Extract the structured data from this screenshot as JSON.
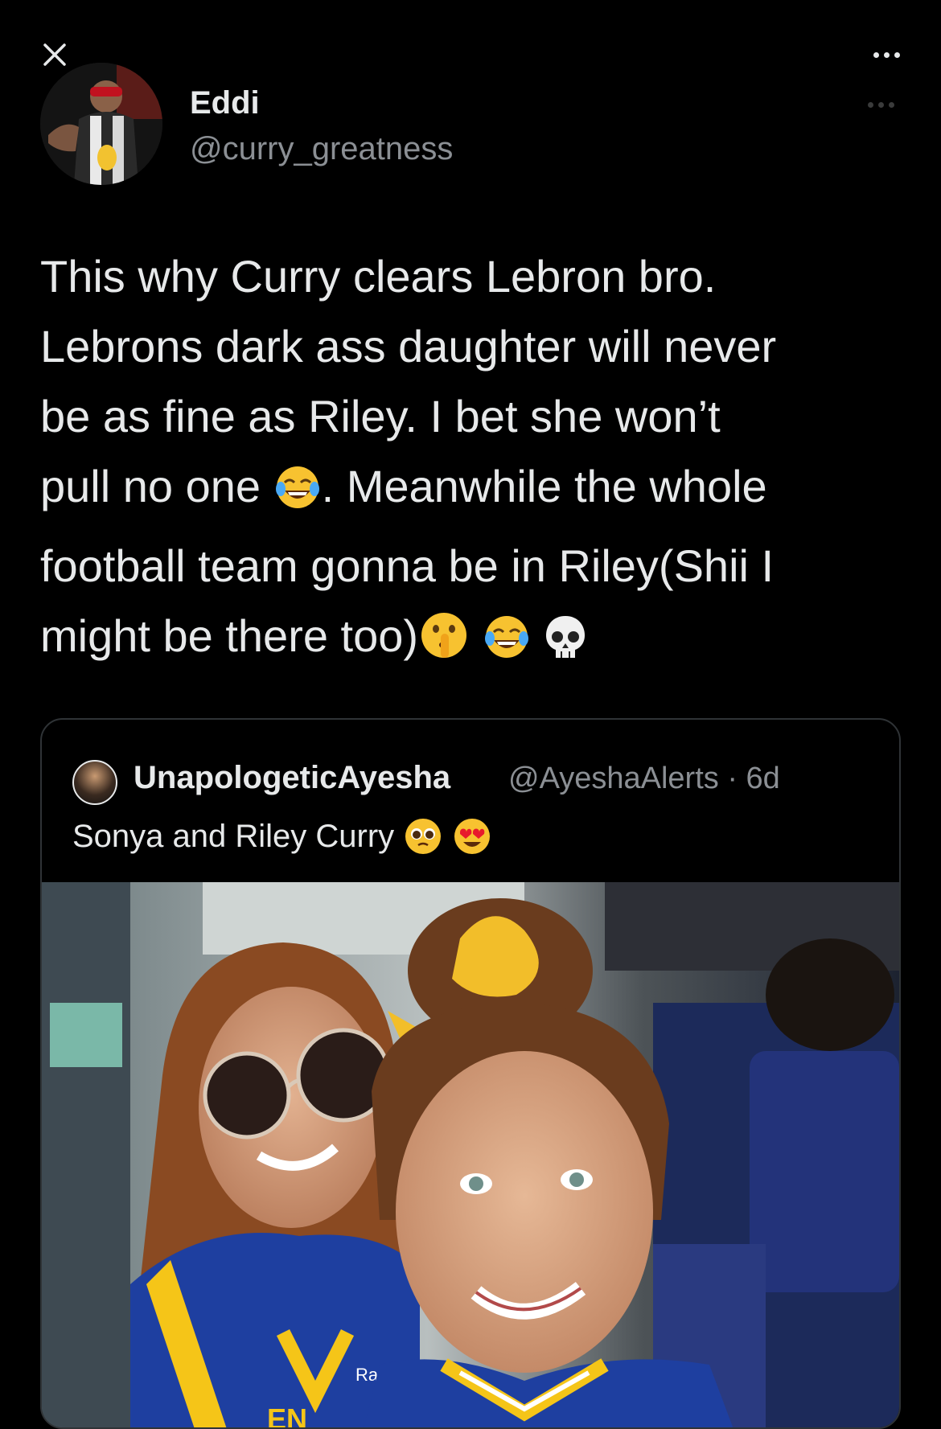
{
  "header": {
    "close_icon": "close-icon",
    "more_icon": "more-horizontal-icon"
  },
  "author": {
    "name": "Eddi",
    "handle": "@curry_greatness"
  },
  "tweet": {
    "line1": "This why Curry clears Lebron bro.",
    "line2": "Lebrons dark ass daughter will never",
    "line3": "be as fine as Riley. I bet she won’t",
    "line4a": "pull no one ",
    "line4b": ". Meanwhile the whole",
    "line5": "football team gonna be in Riley(Shii I",
    "line6": "might be there too)",
    "emojis": [
      "face-with-tears-of-joy",
      "shushing-face",
      "face-with-tears-of-joy",
      "skull"
    ]
  },
  "quote": {
    "name": "UnapologeticAyesha",
    "handle": "@AyeshaAlerts · 6d",
    "text": "Sonya and Riley Curry",
    "emojis": [
      "pleading-face",
      "smiling-face-with-heart-eyes"
    ],
    "photo_jersey_text": "Rak",
    "photo_jersey_bottom": "EN"
  }
}
